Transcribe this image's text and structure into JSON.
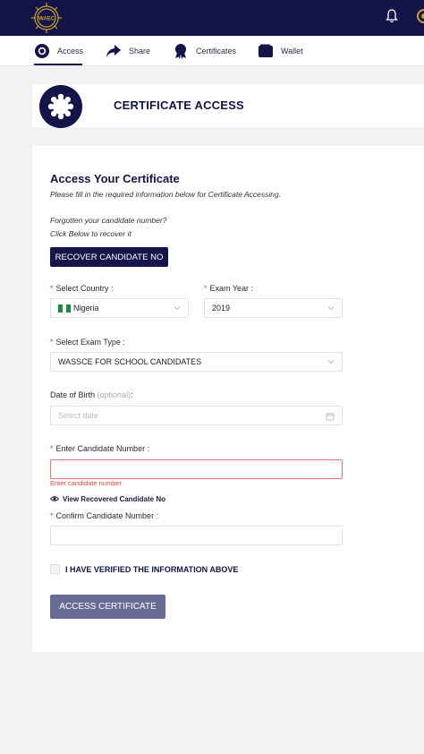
{
  "app": {
    "logo_text": "WAEC"
  },
  "nav": {
    "items": [
      {
        "label": "Access",
        "icon": "access-badge-icon"
      },
      {
        "label": "Share",
        "icon": "share-arrow-icon"
      },
      {
        "label": "Certificates",
        "icon": "certificate-ribbon-icon"
      },
      {
        "label": "Wallet",
        "icon": "wallet-icon"
      }
    ]
  },
  "banner": {
    "title": "CERTIFICATE ACCESS"
  },
  "form": {
    "title": "Access Your Certificate",
    "subtitle": "Please fill in the required information below for Certificate Accessing.",
    "forgot_line1": "Forgotten your candidate number?",
    "forgot_line2": "Click Below to recover it",
    "recover_button": "RECOVER CANDIDATE NO",
    "country": {
      "label": "Select Country",
      "value": "Nigeria"
    },
    "exam_year": {
      "label": "Exam Year",
      "value": "2019"
    },
    "exam_type": {
      "label": "Select Exam Type",
      "value": "WASSCE FOR SCHOOL CANDIDATES"
    },
    "dob": {
      "label": "Date of Birth",
      "optional": "(optional)",
      "placeholder": "Select date"
    },
    "candidate_number": {
      "label": "Enter Candidate Number",
      "value": "",
      "error": "Enter candidate number"
    },
    "view_recovered": "View Recovered Candidate No",
    "confirm_number": {
      "label": "Confirm Candidate Number",
      "value": ""
    },
    "verify_label": "I HAVE VERIFIED THE INFORMATION ABOVE",
    "verify_checked": false,
    "submit_button": "ACCESS CERTIFICATE"
  },
  "colors": {
    "primary": "#14144a",
    "error": "#e0463a",
    "disabled_button": "#6a6a96",
    "flag_green": "#1a8a3c"
  }
}
